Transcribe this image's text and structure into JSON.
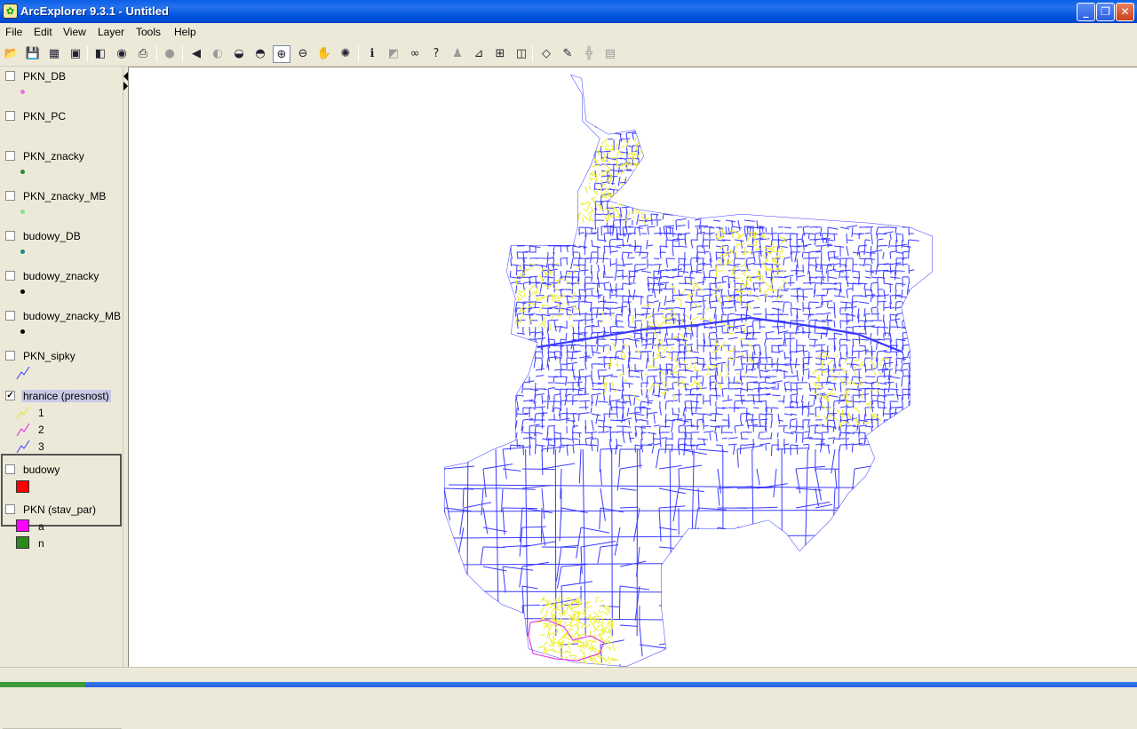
{
  "window": {
    "title": "ArcExplorer 9.3.1 - Untitled",
    "icon": "arcexplorer-icon"
  },
  "menu": [
    "File",
    "Edit",
    "View",
    "Layer",
    "Tools",
    "Help"
  ],
  "toolbar": [
    {
      "name": "open-icon",
      "glyph": "📂"
    },
    {
      "name": "save-icon",
      "glyph": "💾"
    },
    {
      "name": "save-as-icon",
      "glyph": "▦"
    },
    {
      "name": "open-folder-icon",
      "glyph": "▣"
    },
    {
      "name": "add-layer-icon",
      "glyph": "◧"
    },
    {
      "name": "add-internet-layer-icon",
      "glyph": "◉"
    },
    {
      "name": "print-icon",
      "glyph": "⎙"
    },
    {
      "name": "stop-icon",
      "glyph": "●"
    },
    {
      "name": "back-extent-icon",
      "glyph": "◀"
    },
    {
      "name": "forward-extent-icon",
      "glyph": "◐"
    },
    {
      "name": "full-extent-icon",
      "glyph": "◒"
    },
    {
      "name": "zoom-layer-icon",
      "glyph": "◓"
    },
    {
      "name": "zoom-in-icon",
      "glyph": "⊕"
    },
    {
      "name": "zoom-out-icon",
      "glyph": "⊖"
    },
    {
      "name": "pan-icon",
      "glyph": "✋"
    },
    {
      "name": "continuous-pan-icon",
      "glyph": "✺"
    },
    {
      "name": "identify-icon",
      "glyph": "ℹ"
    },
    {
      "name": "map-tips-icon",
      "glyph": "◩"
    },
    {
      "name": "find-icon",
      "glyph": "∞"
    },
    {
      "name": "query-icon",
      "glyph": "?"
    },
    {
      "name": "locate-icon",
      "glyph": "♟"
    },
    {
      "name": "measure-icon",
      "glyph": "⊿"
    },
    {
      "name": "scale-icon",
      "glyph": "⊞"
    },
    {
      "name": "graphics-icon",
      "glyph": "◫"
    },
    {
      "name": "eraser-icon",
      "glyph": "◇"
    },
    {
      "name": "hyperlink-icon",
      "glyph": "✎"
    },
    {
      "name": "grid-icon",
      "glyph": "╬"
    },
    {
      "name": "table-icon",
      "glyph": "▤"
    }
  ],
  "layers": [
    {
      "name": "PKN_DB",
      "checked": false,
      "symbol": "dot",
      "color": "#e870e0"
    },
    {
      "name": "PKN_PC",
      "checked": false,
      "symbol": "none",
      "color": ""
    },
    {
      "name": "PKN_znacky",
      "checked": false,
      "symbol": "dot",
      "color": "#2e8a2e"
    },
    {
      "name": "PKN_znacky_MB",
      "checked": false,
      "symbol": "dot",
      "color": "#8ae08a"
    },
    {
      "name": "budowy_DB",
      "checked": false,
      "symbol": "dot",
      "color": "#1a8a8a"
    },
    {
      "name": "budowy_znacky",
      "checked": false,
      "symbol": "dot",
      "color": "#000000"
    },
    {
      "name": "budowy_znacky_MB",
      "checked": false,
      "symbol": "dot",
      "color": "#000000"
    },
    {
      "name": "PKN_sipky",
      "checked": false,
      "symbol": "line",
      "color": "#3a3aff"
    },
    {
      "name": "hranice (presnost)",
      "checked": true,
      "symbol": "classes",
      "classes": [
        {
          "label": "1",
          "color": "#e8e030"
        },
        {
          "label": "2",
          "color": "#e020e0"
        },
        {
          "label": "3",
          "color": "#3a3aff"
        }
      ]
    },
    {
      "name": "budowy",
      "checked": false,
      "symbol": "square",
      "color": "#ff0000"
    },
    {
      "name": "PKN (stav_par)",
      "checked": false,
      "symbol": "classes-square",
      "classes": [
        {
          "label": "a",
          "color": "#ff00ff"
        },
        {
          "label": "n",
          "color": "#2a8a1a"
        }
      ]
    }
  ],
  "map": {
    "line_color": "#3a3aff",
    "highlight_color": "#f0f040",
    "accent_color": "#e020e0"
  }
}
